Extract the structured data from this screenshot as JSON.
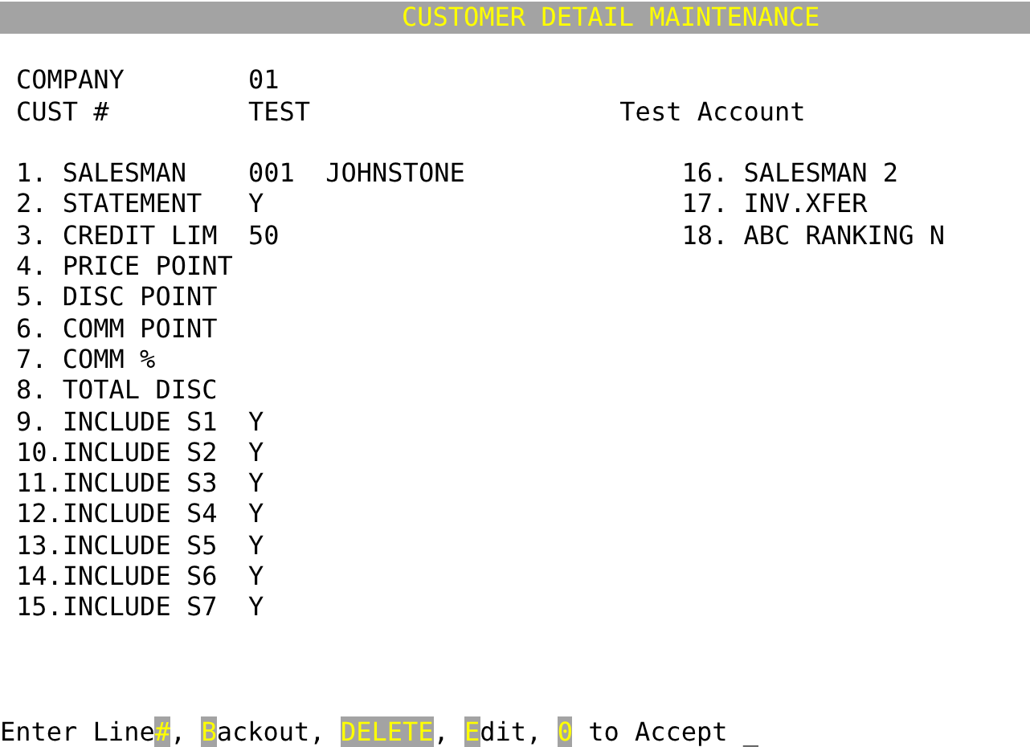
{
  "title": "CUSTOMER DETAIL MAINTENANCE",
  "header": [
    {
      "label": "COMPANY",
      "value": "01"
    },
    {
      "label": "CUST #",
      "value": "TEST",
      "description": "Test Account"
    }
  ],
  "fields_left": [
    {
      "number": "1.",
      "label": "SALESMAN",
      "value": "001",
      "value_2": "JOHNSTONE"
    },
    {
      "number": "2.",
      "label": "STATEMENT",
      "value": "Y"
    },
    {
      "number": "3.",
      "label": "CREDIT LIM",
      "value": "50"
    },
    {
      "number": "4.",
      "label": "PRICE POINT"
    },
    {
      "number": "5.",
      "label": "DISC POINT"
    },
    {
      "number": "6.",
      "label": "COMM POINT"
    },
    {
      "number": "7.",
      "label": "COMM %"
    },
    {
      "number": "8.",
      "label": "TOTAL DISC"
    },
    {
      "number": "9.",
      "label": "INCLUDE S1",
      "value": "Y"
    },
    {
      "number": "10.",
      "label": "INCLUDE S2",
      "value": "Y"
    },
    {
      "number": "11.",
      "label": "INCLUDE S3",
      "value": "Y"
    },
    {
      "number": "12.",
      "label": "INCLUDE S4",
      "value": "Y"
    },
    {
      "number": "13.",
      "label": "INCLUDE S5",
      "value": "Y"
    },
    {
      "number": "14.",
      "label": "INCLUDE S6",
      "value": "Y"
    },
    {
      "number": "15.",
      "label": "INCLUDE S7",
      "value": "Y"
    }
  ],
  "fields_right": [
    {
      "number": "16.",
      "label": "SALESMAN 2"
    },
    {
      "number": "17.",
      "label": "INV.XFER"
    },
    {
      "number": "18.",
      "label": "ABC RANKING",
      "value": "N"
    }
  ],
  "prompt": {
    "segments": [
      {
        "text": "Enter Line",
        "highlight": false
      },
      {
        "text": "#",
        "highlight": true
      },
      {
        "text": ", ",
        "highlight": false
      },
      {
        "text": "B",
        "highlight": true
      },
      {
        "text": "ackout, ",
        "highlight": false
      },
      {
        "text": "DELETE",
        "highlight": true
      },
      {
        "text": ", ",
        "highlight": false
      },
      {
        "text": "E",
        "highlight": true
      },
      {
        "text": "dit, ",
        "highlight": false
      },
      {
        "text": "0",
        "highlight": true
      },
      {
        "text": " to Accept ",
        "highlight": false
      }
    ],
    "cursor": "_"
  }
}
